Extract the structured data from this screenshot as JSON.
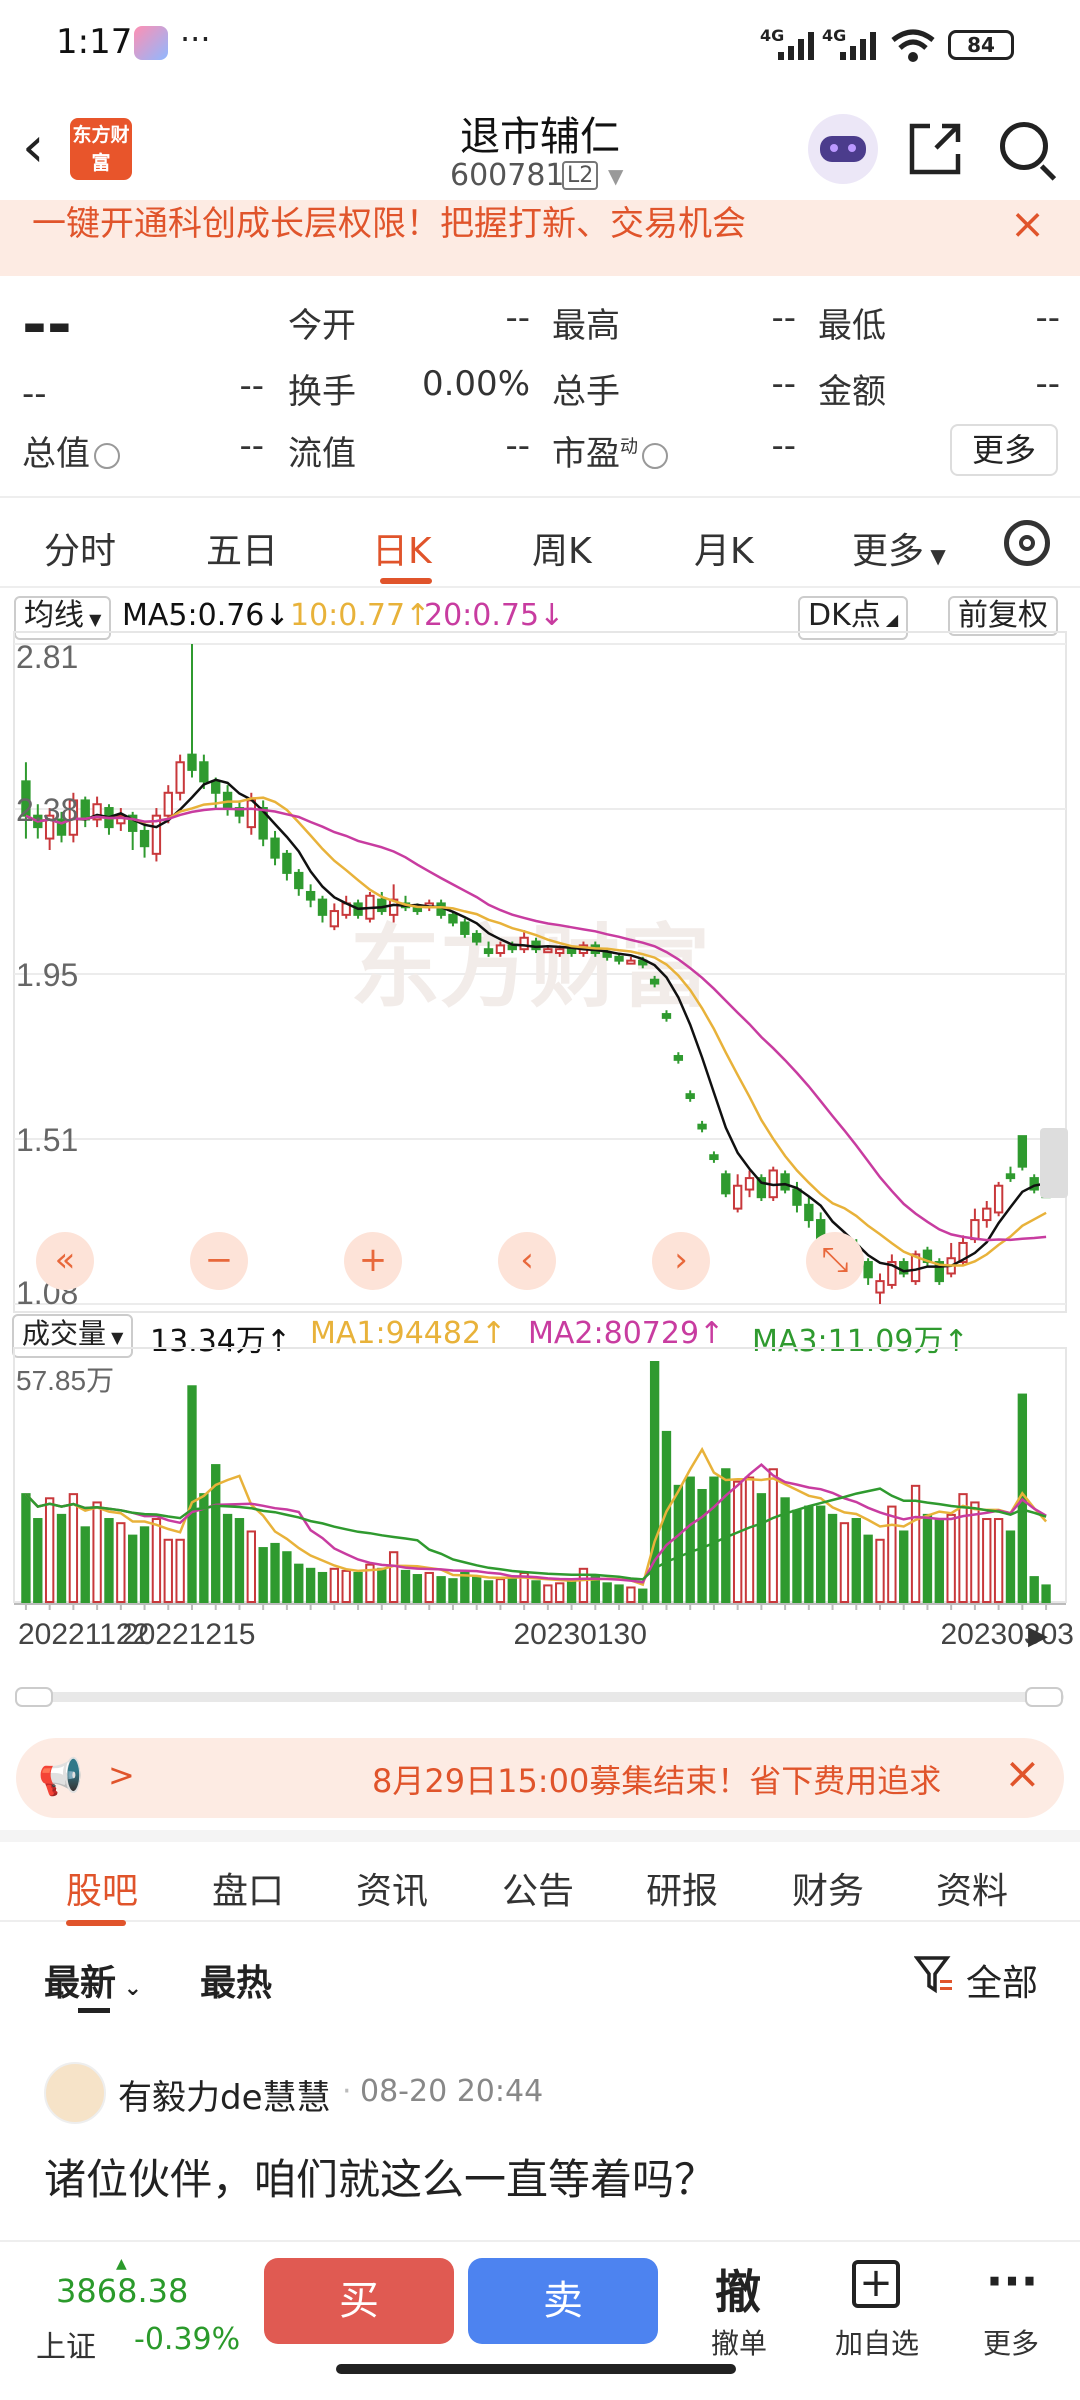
{
  "status": {
    "time": "1:17",
    "more": "···",
    "net1": "4G",
    "net2": "4G",
    "battery": "84"
  },
  "header": {
    "back": "‹",
    "logo": "东方财富",
    "title": "退市辅仁",
    "code": "600781",
    "level": "L2"
  },
  "banner": {
    "text": "一键开通科创成长层权限！把握打新、交易机会",
    "close": "×"
  },
  "quote": {
    "price": "--",
    "change": "--",
    "change_pct": "--",
    "open_label": "今开",
    "open": "--",
    "high_label": "最高",
    "high": "--",
    "low_label": "最低",
    "low": "--",
    "turnover_label": "换手",
    "turnover": "0.00%",
    "volume_label": "总手",
    "volume": "--",
    "amount_label": "金额",
    "amount": "--",
    "mcap_label": "总值",
    "mcap": "--",
    "float_label": "流值",
    "float": "--",
    "pe_label": "市盈",
    "pe_sup": "动",
    "pe": "--",
    "more": "更多"
  },
  "tabs": [
    "分时",
    "五日",
    "日K",
    "周K",
    "月K",
    "更多"
  ],
  "tabs_active": "日K",
  "chart_toolbar": {
    "ma_button": "均线",
    "ma5": "MA5:0.76↓",
    "ma10": "10:0.77↑",
    "ma20": "20:0.75↓",
    "dk": "DK点",
    "adjust": "前复权",
    "vol_button": "成交量",
    "vol_now": "13.34万↑",
    "vma1": "MA1:94482↑",
    "vma2": "MA2:80729↑",
    "vma3": "MA3:11.09万↑",
    "watermark": "东方财富"
  },
  "colors": {
    "up": "#c8383b",
    "down": "#2f9a2f",
    "ma5": "#111111",
    "ma10": "#e8b23a",
    "ma20": "#c83ca0",
    "accent": "#e0542b"
  },
  "chart_data": {
    "type": "candlestick",
    "price_axis_labels": [
      "2.81",
      "2.38",
      "1.95",
      "1.51",
      "1.08"
    ],
    "price_ylim": [
      1.08,
      2.81
    ],
    "volume_axis_label": "57.85万",
    "volume_ylim": [
      0,
      578500
    ],
    "x_tick_labels": [
      "20221122",
      "20221215",
      "20230130",
      "20230303"
    ],
    "candles": [
      {
        "o": 2.45,
        "c": 2.36,
        "h": 2.5,
        "l": 2.3,
        "v": 260000
      },
      {
        "o": 2.36,
        "c": 2.33,
        "h": 2.39,
        "l": 2.3,
        "v": 200000
      },
      {
        "o": 2.3,
        "c": 2.36,
        "h": 2.38,
        "l": 2.27,
        "v": 250000
      },
      {
        "o": 2.35,
        "c": 2.31,
        "h": 2.37,
        "l": 2.29,
        "v": 210000
      },
      {
        "o": 2.31,
        "c": 2.4,
        "h": 2.42,
        "l": 2.29,
        "v": 260000
      },
      {
        "o": 2.4,
        "c": 2.35,
        "h": 2.41,
        "l": 2.33,
        "v": 180000
      },
      {
        "o": 2.35,
        "c": 2.39,
        "h": 2.41,
        "l": 2.33,
        "v": 240000
      },
      {
        "o": 2.38,
        "c": 2.33,
        "h": 2.39,
        "l": 2.31,
        "v": 200000
      },
      {
        "o": 2.34,
        "c": 2.36,
        "h": 2.38,
        "l": 2.32,
        "v": 190000
      },
      {
        "o": 2.36,
        "c": 2.32,
        "h": 2.37,
        "l": 2.27,
        "v": 160000
      },
      {
        "o": 2.32,
        "c": 2.28,
        "h": 2.34,
        "l": 2.25,
        "v": 180000
      },
      {
        "o": 2.26,
        "c": 2.36,
        "h": 2.38,
        "l": 2.24,
        "v": 200000
      },
      {
        "o": 2.36,
        "c": 2.42,
        "h": 2.44,
        "l": 2.34,
        "v": 150000
      },
      {
        "o": 2.42,
        "c": 2.5,
        "h": 2.52,
        "l": 2.4,
        "v": 150000
      },
      {
        "o": 2.52,
        "c": 2.48,
        "h": 2.81,
        "l": 2.46,
        "v": 520000
      },
      {
        "o": 2.5,
        "c": 2.45,
        "h": 2.52,
        "l": 2.43,
        "v": 260000
      },
      {
        "o": 2.45,
        "c": 2.42,
        "h": 2.46,
        "l": 2.38,
        "v": 330000
      },
      {
        "o": 2.42,
        "c": 2.38,
        "h": 2.44,
        "l": 2.36,
        "v": 210000
      },
      {
        "o": 2.38,
        "c": 2.36,
        "h": 2.4,
        "l": 2.34,
        "v": 200000
      },
      {
        "o": 2.33,
        "c": 2.4,
        "h": 2.42,
        "l": 2.31,
        "v": 170000
      },
      {
        "o": 2.38,
        "c": 2.3,
        "h": 2.4,
        "l": 2.28,
        "v": 130000
      },
      {
        "o": 2.3,
        "c": 2.25,
        "h": 2.32,
        "l": 2.23,
        "v": 140000
      },
      {
        "o": 2.26,
        "c": 2.21,
        "h": 2.27,
        "l": 2.19,
        "v": 120000
      },
      {
        "o": 2.21,
        "c": 2.17,
        "h": 2.22,
        "l": 2.15,
        "v": 90000
      },
      {
        "o": 2.16,
        "c": 2.14,
        "h": 2.18,
        "l": 2.12,
        "v": 80000
      },
      {
        "o": 2.14,
        "c": 2.1,
        "h": 2.15,
        "l": 2.08,
        "v": 70000
      },
      {
        "o": 2.07,
        "c": 2.11,
        "h": 2.13,
        "l": 2.06,
        "v": 80000
      },
      {
        "o": 2.1,
        "c": 2.13,
        "h": 2.15,
        "l": 2.09,
        "v": 75000
      },
      {
        "o": 2.13,
        "c": 2.1,
        "h": 2.14,
        "l": 2.09,
        "v": 70000
      },
      {
        "o": 2.09,
        "c": 2.15,
        "h": 2.16,
        "l": 2.08,
        "v": 90000
      },
      {
        "o": 2.14,
        "c": 2.11,
        "h": 2.16,
        "l": 2.1,
        "v": 80000
      },
      {
        "o": 2.1,
        "c": 2.14,
        "h": 2.18,
        "l": 2.08,
        "v": 120000
      },
      {
        "o": 2.13,
        "c": 2.12,
        "h": 2.15,
        "l": 2.11,
        "v": 75000
      },
      {
        "o": 2.12,
        "c": 2.11,
        "h": 2.13,
        "l": 2.1,
        "v": 65000
      },
      {
        "o": 2.12,
        "c": 2.13,
        "h": 2.14,
        "l": 2.11,
        "v": 70000
      },
      {
        "o": 2.13,
        "c": 2.1,
        "h": 2.14,
        "l": 2.09,
        "v": 60000
      },
      {
        "o": 2.1,
        "c": 2.08,
        "h": 2.11,
        "l": 2.07,
        "v": 55000
      },
      {
        "o": 2.08,
        "c": 2.05,
        "h": 2.09,
        "l": 2.04,
        "v": 70000
      },
      {
        "o": 2.05,
        "c": 2.03,
        "h": 2.06,
        "l": 2.02,
        "v": 60000
      },
      {
        "o": 2.01,
        "c": 2.0,
        "h": 2.03,
        "l": 1.99,
        "v": 50000
      },
      {
        "o": 2.0,
        "c": 2.02,
        "h": 2.03,
        "l": 1.99,
        "v": 55000
      },
      {
        "o": 2.02,
        "c": 2.01,
        "h": 2.03,
        "l": 2.0,
        "v": 60000
      },
      {
        "o": 2.01,
        "c": 2.04,
        "h": 2.06,
        "l": 2.0,
        "v": 70000
      },
      {
        "o": 2.03,
        "c": 2.01,
        "h": 2.04,
        "l": 2.0,
        "v": 50000
      },
      {
        "o": 2.01,
        "c": 2.01,
        "h": 2.02,
        "l": 2.0,
        "v": 40000
      },
      {
        "o": 2.0,
        "c": 2.01,
        "h": 2.02,
        "l": 1.99,
        "v": 45000
      },
      {
        "o": 2.01,
        "c": 2.0,
        "h": 2.02,
        "l": 1.99,
        "v": 50000
      },
      {
        "o": 2.0,
        "c": 2.02,
        "h": 2.03,
        "l": 1.99,
        "v": 80000
      },
      {
        "o": 2.02,
        "c": 2.0,
        "h": 2.03,
        "l": 1.99,
        "v": 60000
      },
      {
        "o": 2.0,
        "c": 1.99,
        "h": 2.01,
        "l": 1.98,
        "v": 45000
      },
      {
        "o": 1.99,
        "c": 1.98,
        "h": 2.0,
        "l": 1.97,
        "v": 40000
      },
      {
        "o": 1.98,
        "c": 1.98,
        "h": 1.99,
        "l": 1.97,
        "v": 35000
      },
      {
        "o": 1.98,
        "c": 1.97,
        "h": 1.99,
        "l": 1.96,
        "v": 30000
      },
      {
        "o": 1.93,
        "c": 1.92,
        "h": 1.94,
        "l": 1.91,
        "v": 578500
      },
      {
        "o": 1.84,
        "c": 1.83,
        "h": 1.85,
        "l": 1.82,
        "v": 410000
      },
      {
        "o": 1.73,
        "c": 1.72,
        "h": 1.74,
        "l": 1.71,
        "v": 280000
      },
      {
        "o": 1.63,
        "c": 1.62,
        "h": 1.64,
        "l": 1.61,
        "v": 300000
      },
      {
        "o": 1.55,
        "c": 1.54,
        "h": 1.56,
        "l": 1.53,
        "v": 270000
      },
      {
        "o": 1.47,
        "c": 1.46,
        "h": 1.48,
        "l": 1.45,
        "v": 300000
      },
      {
        "o": 1.42,
        "c": 1.37,
        "h": 1.43,
        "l": 1.36,
        "v": 320000
      },
      {
        "o": 1.33,
        "c": 1.39,
        "h": 1.42,
        "l": 1.32,
        "v": 290000
      },
      {
        "o": 1.38,
        "c": 1.41,
        "h": 1.43,
        "l": 1.36,
        "v": 300000
      },
      {
        "o": 1.41,
        "c": 1.36,
        "h": 1.42,
        "l": 1.35,
        "v": 260000
      },
      {
        "o": 1.36,
        "c": 1.43,
        "h": 1.44,
        "l": 1.35,
        "v": 320000
      },
      {
        "o": 1.42,
        "c": 1.38,
        "h": 1.43,
        "l": 1.37,
        "v": 250000
      },
      {
        "o": 1.38,
        "c": 1.34,
        "h": 1.4,
        "l": 1.32,
        "v": 220000
      },
      {
        "o": 1.34,
        "c": 1.3,
        "h": 1.36,
        "l": 1.28,
        "v": 230000
      },
      {
        "o": 1.3,
        "c": 1.24,
        "h": 1.32,
        "l": 1.22,
        "v": 230000
      },
      {
        "o": 1.24,
        "c": 1.22,
        "h": 1.26,
        "l": 1.2,
        "v": 210000
      },
      {
        "o": 1.21,
        "c": 1.24,
        "h": 1.27,
        "l": 1.2,
        "v": 190000
      },
      {
        "o": 1.23,
        "c": 1.19,
        "h": 1.25,
        "l": 1.17,
        "v": 200000
      },
      {
        "o": 1.19,
        "c": 1.15,
        "h": 1.2,
        "l": 1.13,
        "v": 160000
      },
      {
        "o": 1.11,
        "c": 1.14,
        "h": 1.16,
        "l": 1.08,
        "v": 150000
      },
      {
        "o": 1.13,
        "c": 1.19,
        "h": 1.21,
        "l": 1.12,
        "v": 230000
      },
      {
        "o": 1.19,
        "c": 1.16,
        "h": 1.2,
        "l": 1.15,
        "v": 170000
      },
      {
        "o": 1.14,
        "c": 1.21,
        "h": 1.22,
        "l": 1.13,
        "v": 280000
      },
      {
        "o": 1.22,
        "c": 1.19,
        "h": 1.23,
        "l": 1.18,
        "v": 210000
      },
      {
        "o": 1.19,
        "c": 1.14,
        "h": 1.2,
        "l": 1.13,
        "v": 200000
      },
      {
        "o": 1.16,
        "c": 1.2,
        "h": 1.24,
        "l": 1.15,
        "v": 210000
      },
      {
        "o": 1.19,
        "c": 1.24,
        "h": 1.26,
        "l": 1.18,
        "v": 260000
      },
      {
        "o": 1.25,
        "c": 1.3,
        "h": 1.33,
        "l": 1.24,
        "v": 240000
      },
      {
        "o": 1.3,
        "c": 1.33,
        "h": 1.35,
        "l": 1.28,
        "v": 200000
      },
      {
        "o": 1.32,
        "c": 1.39,
        "h": 1.4,
        "l": 1.31,
        "v": 200000
      },
      {
        "o": 1.42,
        "c": 1.41,
        "h": 1.44,
        "l": 1.4,
        "v": 170000
      },
      {
        "o": 1.52,
        "c": 1.44,
        "h": 1.52,
        "l": 1.43,
        "v": 500000
      },
      {
        "o": 1.41,
        "c": 1.38,
        "h": 1.42,
        "l": 1.37,
        "v": 60000
      },
      {
        "o": 1.37,
        "c": 1.36,
        "h": 1.38,
        "l": 1.36,
        "v": 40000
      }
    ]
  },
  "chart_controls": [
    "«",
    "−",
    "+",
    "‹",
    "›",
    "⤡"
  ],
  "notice": {
    "text": "8月29日15:00募集结束！省下费用追求",
    "prefix": ">",
    "close": "×"
  },
  "subtabs": [
    "股吧",
    "盘口",
    "资讯",
    "公告",
    "研报",
    "财务",
    "资料"
  ],
  "subtabs_active": "股吧",
  "filter": {
    "latest": "最新",
    "hot": "最热",
    "all": "全部"
  },
  "post": {
    "author": "有毅力de慧慧",
    "time": "08-20 20:44",
    "text": "诸位伙伴，咱们就这么一直等着吗？"
  },
  "bottombar": {
    "index_value": "3868.38",
    "index_name": "上证",
    "index_change": "-0.39%",
    "buy": "买",
    "sell": "卖",
    "cancel_icon": "撤",
    "cancel": "撤单",
    "add_icon": "+",
    "add": "加自选",
    "more_icon": "···",
    "more": "更多"
  }
}
